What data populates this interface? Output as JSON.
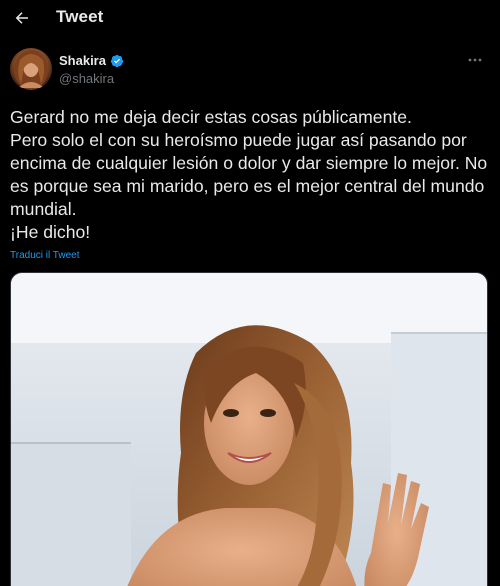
{
  "header": {
    "title": "Tweet",
    "back_icon": "arrow-left-icon"
  },
  "author": {
    "display_name": "Shakira",
    "handle": "@shakira",
    "verified_icon": "verified-badge-icon",
    "more_icon": "more-horizontal-icon"
  },
  "tweet": {
    "text": "Gerard no me deja decir estas cosas públicamente.\nPero solo el con su heroísmo puede jugar así pasando por encima de cualquier lesión o dolor y dar siempre lo mejor. No es porque sea mi marido, pero es el mejor central del mundo mundial.\n¡He dicho!",
    "translate_label": "Traduci il Tweet"
  },
  "colors": {
    "background": "#000000",
    "text": "#e7e9ea",
    "secondary_text": "#71767b",
    "link": "#1d9bf0",
    "verified": "#1d9bf0"
  }
}
